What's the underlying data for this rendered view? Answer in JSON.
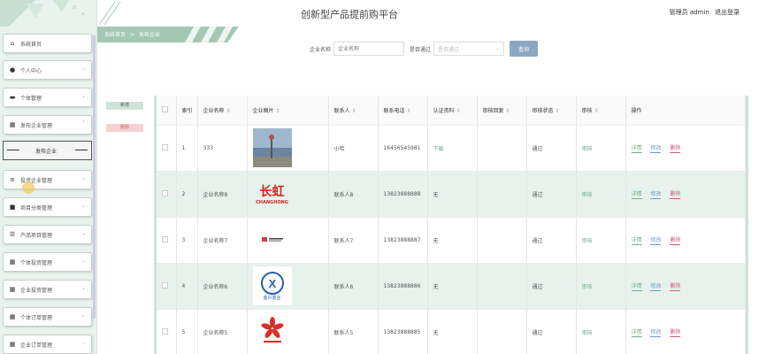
{
  "header": {
    "title": "创新型产品提前购平台",
    "user_label": "管理员 admin",
    "logout_label": "退出登录"
  },
  "breadcrumb": {
    "home": "系统首页",
    "sep": ">",
    "current": "发布企业"
  },
  "sidebar": {
    "items": [
      {
        "label": "系统首页",
        "icon": "home-icon"
      },
      {
        "label": "个人中心",
        "icon": "user-icon"
      },
      {
        "label": "个体管理",
        "icon": "monitor-icon"
      },
      {
        "label": "发布企业管理",
        "icon": "grid-icon",
        "expanded": true
      },
      {
        "label": "投资企业管理",
        "icon": "document-icon"
      },
      {
        "label": "项目分类管理",
        "icon": "folder-icon"
      },
      {
        "label": "产品项目管理",
        "icon": "list-icon"
      },
      {
        "label": "个体投资管理",
        "icon": "grid-icon"
      },
      {
        "label": "企业投资管理",
        "icon": "grid-icon"
      },
      {
        "label": "个体订单管理",
        "icon": "grid-icon"
      },
      {
        "label": "企业订单管理",
        "icon": "grid-icon"
      }
    ],
    "submenu_label": "发布企业"
  },
  "search": {
    "name_label": "企业名称",
    "name_placeholder": "企业名称",
    "pass_label": "是否通过",
    "pass_placeholder": "是否通过",
    "button_label": "查询"
  },
  "actions": {
    "add_label": "新增",
    "delete_label": "删除"
  },
  "table": {
    "columns": [
      "",
      "索引",
      "企业名称",
      "企业图片",
      "联系人",
      "联系电话",
      "认证资料",
      "审核回复",
      "审核状态",
      "审核",
      "操作"
    ],
    "rows": [
      {
        "index": "1",
        "name": "333",
        "image": "landscape-photo",
        "contact": "小哈",
        "phone": "16456545981",
        "cert": "下载",
        "reply": "",
        "status": "通过",
        "review": "审核"
      },
      {
        "index": "2",
        "name": "企业名称8",
        "image": "changhong-logo",
        "contact": "联系人8",
        "phone": "13823888888",
        "cert": "无",
        "reply": "",
        "status": "通过",
        "review": "审核"
      },
      {
        "index": "3",
        "name": "企业名称7",
        "image": "small-logo",
        "contact": "联系人7",
        "phone": "13823888887",
        "cert": "无",
        "reply": "",
        "status": "通过",
        "review": "审核"
      },
      {
        "index": "4",
        "name": "企业名称6",
        "image": "jinxing-logo",
        "contact": "联系人6",
        "phone": "13823888886",
        "cert": "无",
        "reply": "",
        "status": "通过",
        "review": "审核"
      },
      {
        "index": "5",
        "name": "企业名称5",
        "image": "flower-logo",
        "contact": "联系人5",
        "phone": "13823888885",
        "cert": "无",
        "reply": "",
        "status": "通过",
        "review": "审核"
      }
    ],
    "op_labels": {
      "detail": "详情",
      "edit": "修改",
      "delete": "删除"
    }
  },
  "logos": {
    "changhong_cn": "长虹",
    "changhong_en": "CHANGHONG",
    "jinxing_cn": "金兴置业"
  },
  "colors": {
    "accent": "#a4c8b4",
    "sidebar_bg": "#e9f3ee",
    "row_alt": "#e6f2eb",
    "search_btn": "#8aa8c2"
  }
}
